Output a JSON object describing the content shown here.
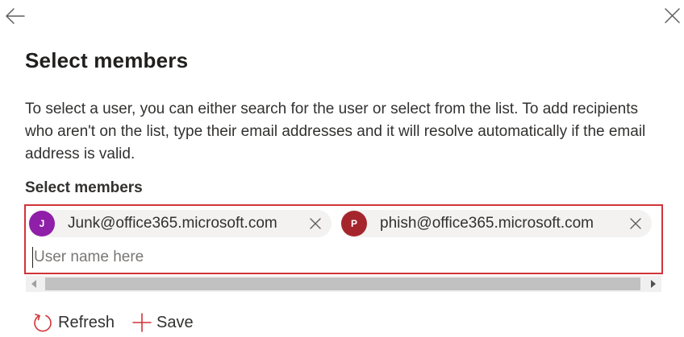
{
  "header": {
    "back_icon": "arrow-left-icon",
    "close_icon": "close-icon"
  },
  "title": "Select members",
  "description": "To select a user, you can either search for the user or select from the list. To add recipients who aren't on the list, type their email addresses and it will resolve automatically if the email address is valid.",
  "field_label": "Select members",
  "picker": {
    "border_color": "#d13438",
    "chips": [
      {
        "initial": "J",
        "email": "Junk@office365.microsoft.com",
        "avatar_color": "#8f1ea8"
      },
      {
        "initial": "P",
        "email": "phish@office365.microsoft.com",
        "avatar_color": "#a4262c"
      }
    ],
    "input_placeholder": "User name here",
    "input_value": ""
  },
  "toolbar": {
    "refresh_label": "Refresh",
    "save_label": "Save",
    "accent_color": "#d13438"
  }
}
